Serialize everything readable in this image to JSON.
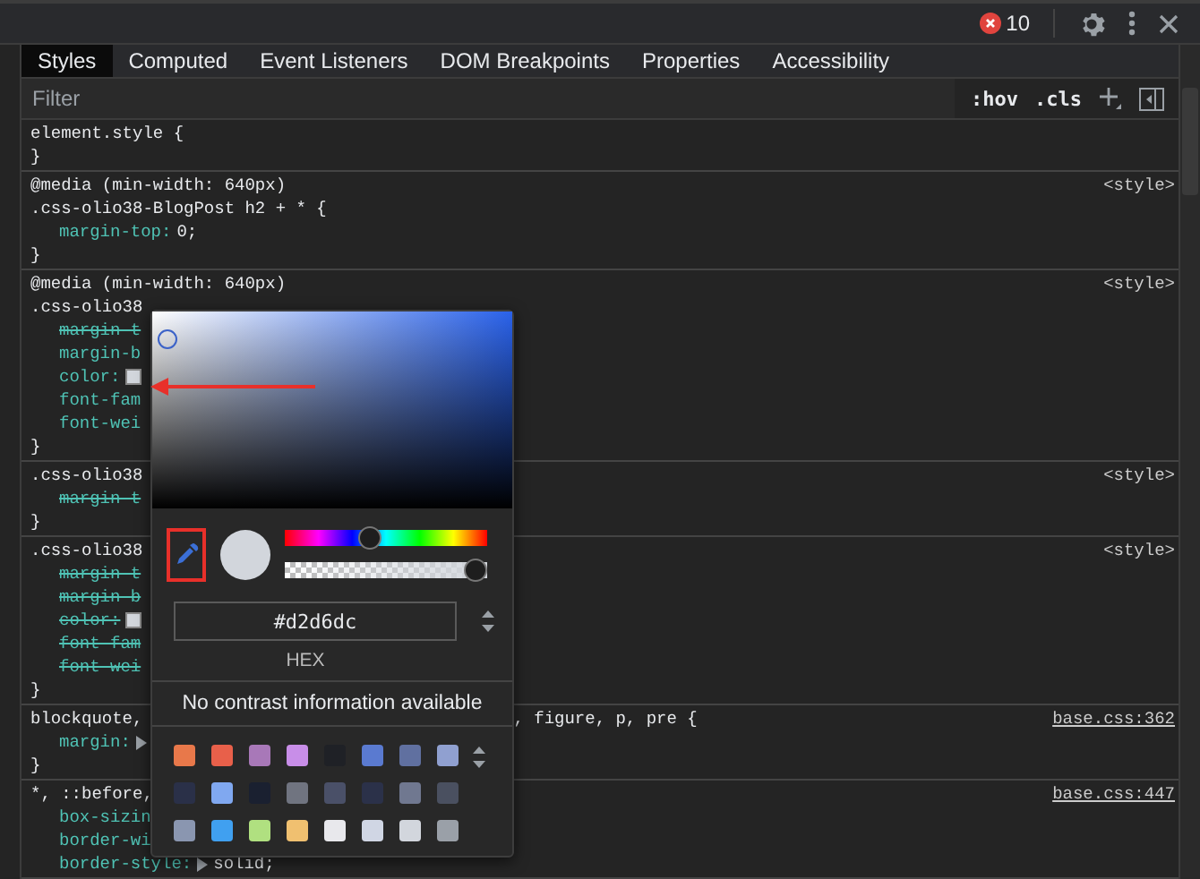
{
  "toolbar": {
    "error_count": "10"
  },
  "tabs": [
    {
      "label": "Styles",
      "selected": true
    },
    {
      "label": "Computed",
      "selected": false
    },
    {
      "label": "Event Listeners",
      "selected": false
    },
    {
      "label": "DOM Breakpoints",
      "selected": false
    },
    {
      "label": "Properties",
      "selected": false
    },
    {
      "label": "Accessibility",
      "selected": false
    }
  ],
  "filter": {
    "placeholder": "Filter",
    "hov": ":hov",
    "cls": ".cls"
  },
  "rules": [
    {
      "selector_lines": [
        "element.style {"
      ],
      "closing": "}"
    },
    {
      "selector_lines": [
        "@media (min-width: 640px)",
        ".css-olio38-BlogPost h2 + * {"
      ],
      "source": "<style>",
      "link": false,
      "props": [
        {
          "name": "margin-top:",
          "value": "0;",
          "struck": false
        }
      ],
      "closing": "}"
    },
    {
      "selector_lines": [
        "@media (min-width: 640px)",
        ".css-olio38"
      ],
      "source": "<style>",
      "link": false,
      "props": [
        {
          "name": "margin-t",
          "struck": true
        },
        {
          "name": "margin-b",
          "struck": false
        },
        {
          "name": "color:",
          "color": "#d2d6dc",
          "struck": false
        },
        {
          "name": "font-fam",
          "struck": false
        },
        {
          "name": "font-wei",
          "struck": false
        }
      ],
      "closing": "}"
    },
    {
      "selector_lines": [
        ".css-olio38"
      ],
      "source": "<style>",
      "link": false,
      "props": [
        {
          "name": "margin-t",
          "struck": true
        }
      ],
      "closing": "}"
    },
    {
      "selector_lines": [
        ".css-olio38"
      ],
      "source": "<style>",
      "link": false,
      "props": [
        {
          "name": "margin-t",
          "struck": true
        },
        {
          "name": "margin-b",
          "struck": true
        },
        {
          "name": "color:",
          "color": "#d2d6dc",
          "struck": true
        },
        {
          "name": "font-fam",
          "struck": true
        },
        {
          "name": "font-wei",
          "struck": true
        }
      ],
      "closing": "}"
    },
    {
      "selector_lines": [
        "blockquote,"
      ],
      "selector_tail": ", figure, p, pre {",
      "source": "base.css:362",
      "link": true,
      "props": [
        {
          "name": "margin:",
          "expandable": true,
          "struck": false
        }
      ],
      "closing": "}"
    },
    {
      "selector_lines": [
        "*, ::before,"
      ],
      "source": "base.css:447",
      "link": true,
      "props": [
        {
          "name": "box-sizin",
          "struck": false
        },
        {
          "name": "border-wi",
          "struck": false
        },
        {
          "name": "border-style:",
          "expandable": true,
          "value": "solid;",
          "struck": false
        }
      ]
    }
  ],
  "color_picker": {
    "hue": {
      "level": 0.41
    },
    "alpha": {
      "level": 1
    },
    "value": "#d2d6dc",
    "format": "HEX",
    "contrast": "No contrast information available",
    "swatches": [
      {
        "color": "#e8784a"
      },
      {
        "color": "#e8604a"
      },
      {
        "color": "#a878b8"
      },
      {
        "color": "#c88ee8"
      },
      {
        "color": "#1f2126"
      },
      {
        "color": "#5a7ad0"
      },
      {
        "color": "#6070a0"
      },
      {
        "color": "#90a0d0"
      },
      {
        "color": "#2a3048"
      },
      {
        "color": "#80a8f0"
      },
      {
        "color": "#1a2030"
      },
      {
        "color": "#707480"
      },
      {
        "color": "#4a5068"
      },
      {
        "color": "#2b3149"
      },
      {
        "color": "#707890"
      },
      {
        "color": "#4a5060"
      },
      {
        "color": "#8a96b0"
      },
      {
        "color": "#40a0f0"
      },
      {
        "color": "#b0e080"
      },
      {
        "color": "#f0c070"
      },
      {
        "color": "#e8e8ec"
      },
      {
        "color": "#d0d6e4"
      },
      {
        "color": "#d2d6dd"
      },
      {
        "color": "#9aa0a8"
      }
    ]
  }
}
